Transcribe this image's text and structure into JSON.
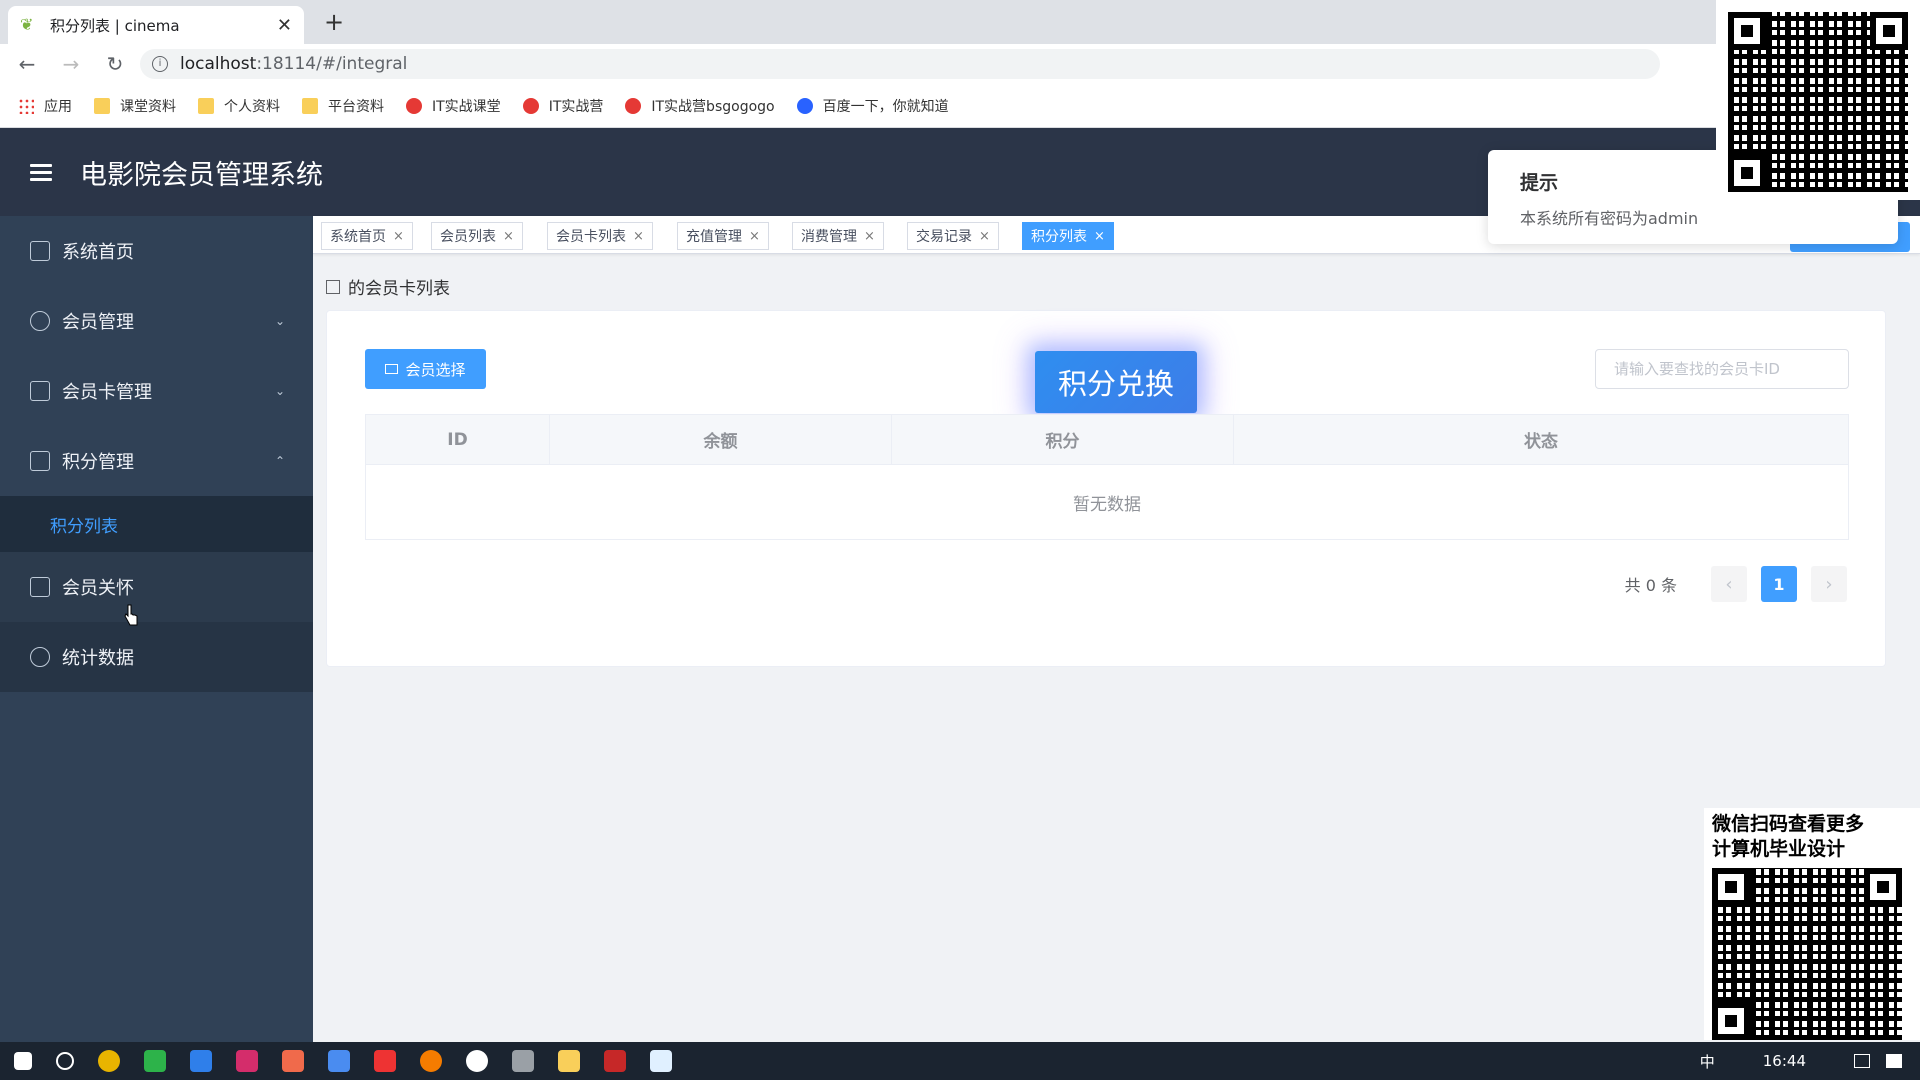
{
  "browser": {
    "tab_title": "积分列表 | cinema",
    "tab_close": "✕",
    "new_tab": "+",
    "url_host": "localhost",
    "url_rest": ":18114/#/integral",
    "bookmarks": [
      "应用",
      "课堂资料",
      "个人资料",
      "平台资料",
      "IT实战课堂",
      "IT实战营",
      "IT实战营bsgogogo",
      "百度一下，你就知道"
    ]
  },
  "header": {
    "title": "电影院会员管理系统"
  },
  "sidebar": {
    "items": [
      {
        "label": "系统首页",
        "icon": "home-icon"
      },
      {
        "label": "会员管理",
        "icon": "user-icon",
        "chevron": "⌄"
      },
      {
        "label": "会员卡管理",
        "icon": "card-doc-icon",
        "chevron": "⌄"
      },
      {
        "label": "积分管理",
        "icon": "grid-icon",
        "chevron": "⌃"
      },
      {
        "label": "积分列表"
      },
      {
        "label": "会员关怀",
        "icon": "calendar-icon"
      },
      {
        "label": "统计数据",
        "icon": "pie-chart-icon"
      }
    ]
  },
  "tags": [
    "系统首页",
    "会员列表",
    "会员卡列表",
    "充值管理",
    "消费管理",
    "交易记录",
    "积分列表"
  ],
  "tag_close": "×",
  "notification": {
    "title": "提示",
    "body": "本系统所有密码为admin"
  },
  "breadcrumb": "的会员卡列表",
  "toolbar": {
    "member_select": "会员选择",
    "search_placeholder": "请输入要查找的会员卡ID"
  },
  "overlay_title": "积分兑换",
  "table": {
    "columns": [
      "ID",
      "余额",
      "积分",
      "状态"
    ],
    "empty_text": "暂无数据"
  },
  "pagination": {
    "total": "共 0 条",
    "prev": "‹",
    "current": "1",
    "next": "›"
  },
  "qr_caption": [
    "微信扫码查看更多",
    "计算机毕业设计"
  ],
  "taskbar": {
    "time": "16:44",
    "ime": "中"
  }
}
